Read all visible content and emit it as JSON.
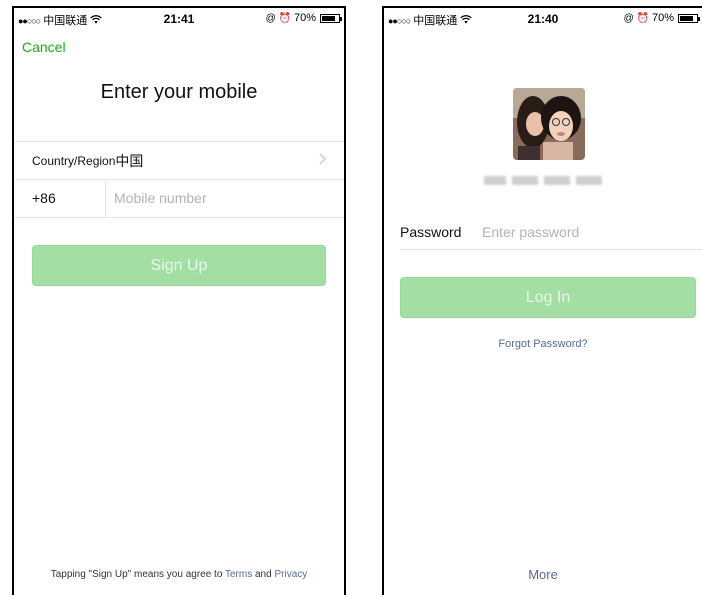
{
  "left_screen": {
    "status": {
      "signal": "●●○○○",
      "carrier": "中国联通",
      "wifi_icon": "wifi-icon",
      "time": "21:41",
      "icons": "@ ⏰",
      "battery": "70%"
    },
    "cancel_label": "Cancel",
    "title": "Enter your mobile",
    "country_label": "Country/Region",
    "country_value": "中国",
    "country_code": "+86",
    "mobile_placeholder": "Mobile number",
    "signup_label": "Sign Up",
    "terms": {
      "prefix": "Tapping \"Sign Up\" means you agree to ",
      "terms_link": "Terms",
      "and": " and ",
      "privacy_link": "Privacy"
    },
    "colors": {
      "accent": "#1aad19",
      "button_disabled": "#a3dea3",
      "link": "#576b95"
    }
  },
  "right_screen": {
    "status": {
      "signal": "●●○○○",
      "carrier": "中国联通",
      "wifi_icon": "wifi-icon",
      "time": "21:40",
      "icons": "@ ⏰",
      "battery": "70%"
    },
    "password_label": "Password",
    "password_placeholder": "Enter password",
    "login_label": "Log In",
    "forgot_label": "Forgot Password?",
    "more_label": "More"
  }
}
